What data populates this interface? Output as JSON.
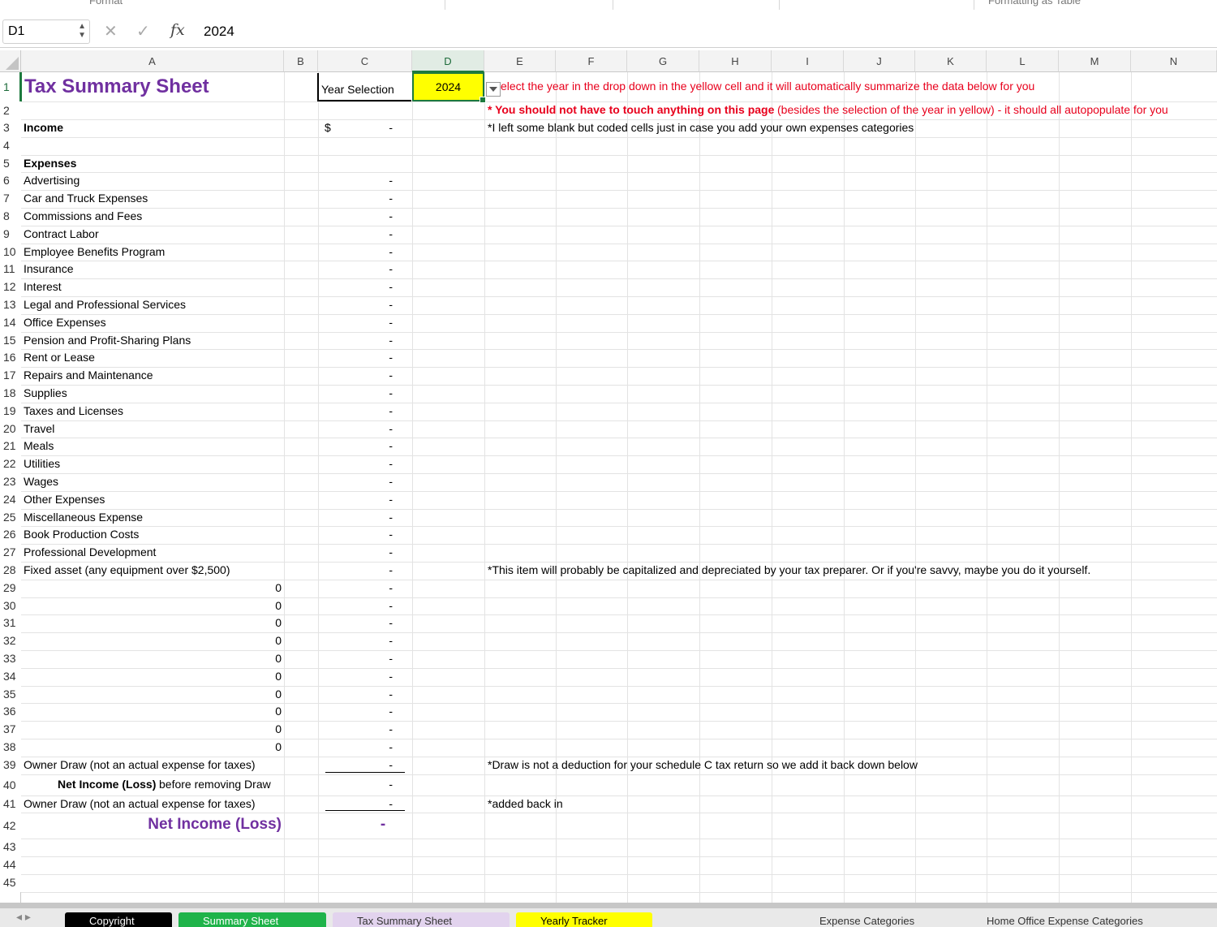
{
  "ribbon": {
    "format_label": "Format",
    "formatting_label": "Formatting  as Table"
  },
  "formula_bar": {
    "cell_ref": "D1",
    "cancel_icon": "x-icon",
    "enter_icon": "check-icon",
    "fx_label": "fx",
    "value": "2024"
  },
  "columns": [
    "A",
    "B",
    "C",
    "D",
    "E",
    "F",
    "G",
    "H",
    "I",
    "J",
    "K",
    "L",
    "M",
    "N"
  ],
  "rows": [
    "1",
    "2",
    "3",
    "4",
    "5",
    "6",
    "7",
    "8",
    "9",
    "10",
    "11",
    "12",
    "13",
    "14",
    "15",
    "16",
    "17",
    "18",
    "19",
    "20",
    "21",
    "22",
    "23",
    "24",
    "25",
    "26",
    "27",
    "28",
    "29",
    "30",
    "31",
    "32",
    "33",
    "34",
    "35",
    "36",
    "37",
    "38",
    "39",
    "40",
    "41",
    "42",
    "43",
    "44",
    "45"
  ],
  "sheet": {
    "title": "Tax Summary Sheet",
    "year_selection_label": "Year Selection",
    "year_value": "2024",
    "income_label": "Income",
    "income_currency": "$",
    "income_value": "-",
    "expenses_label": "Expenses",
    "expense_items": [
      "Advertising",
      "Car and Truck Expenses",
      "Commissions and Fees",
      "Contract Labor",
      "Employee Benefits Program",
      "Insurance",
      "Interest",
      "Legal and Professional Services",
      "Office Expenses",
      "Pension and Profit-Sharing Plans",
      "Rent or Lease",
      "Repairs and Maintenance",
      "Supplies",
      "Taxes and Licenses",
      "Travel",
      "Meals",
      "Utilities",
      "Wages",
      "Other Expenses",
      "Miscellaneous Expense",
      "Book Production Costs",
      "Professional Development",
      "Fixed asset (any equipment over $2,500)"
    ],
    "blank_coded_value": "0",
    "dash": "-",
    "owner_draw_label": "Owner Draw (not an actual expense for taxes)",
    "net_before_bold": "Net Income (Loss)",
    "net_before_rest": " before removing Draw",
    "owner_draw_label_2": "Owner Draw (not an actual expense for taxes)",
    "net_income_label": "Net Income (Loss)",
    "net_income_value": "-"
  },
  "notes": {
    "e1": "elect the year in the drop down in the yellow cell and it will automatically summarize the data below for you",
    "e2_bold": "* You should not have to touch anything on this page",
    "e2_rest": " (besides the selection of the year in yellow) - it should all autopopulate for you",
    "e3": "*I left some blank but coded cells just in case you add your own expenses categories",
    "e28": "*This item will probably be capitalized and depreciated by your tax preparer. Or if you're savvy, maybe you do it yourself.",
    "e39": "*Draw is not a deduction for your schedule C tax return so we add it back down below",
    "e41": "*added back in"
  },
  "tabs": [
    {
      "label": "Copyright",
      "color": "#000000",
      "text_color": "#ffffff"
    },
    {
      "label": "Summary Sheet",
      "color": "#1fb34a",
      "text_color": "#ffffff"
    },
    {
      "label": "Tax Summary Sheet",
      "color": "#e2d3ee",
      "text_color": "#333333"
    },
    {
      "label": "Yearly Tracker",
      "color": "#ffff00",
      "text_color": "#000000"
    },
    {
      "label": "Expense Categories",
      "color": "#e9e9e9",
      "text_color": "#333333"
    },
    {
      "label": "Home Office Expense Categories",
      "color": "#e9e9e9",
      "text_color": "#333333"
    }
  ],
  "colors": {
    "accent_purple": "#7030a0",
    "note_red": "#e8001c",
    "selected_yellow": "#ffff00",
    "selection_green": "#1d7a3e"
  }
}
